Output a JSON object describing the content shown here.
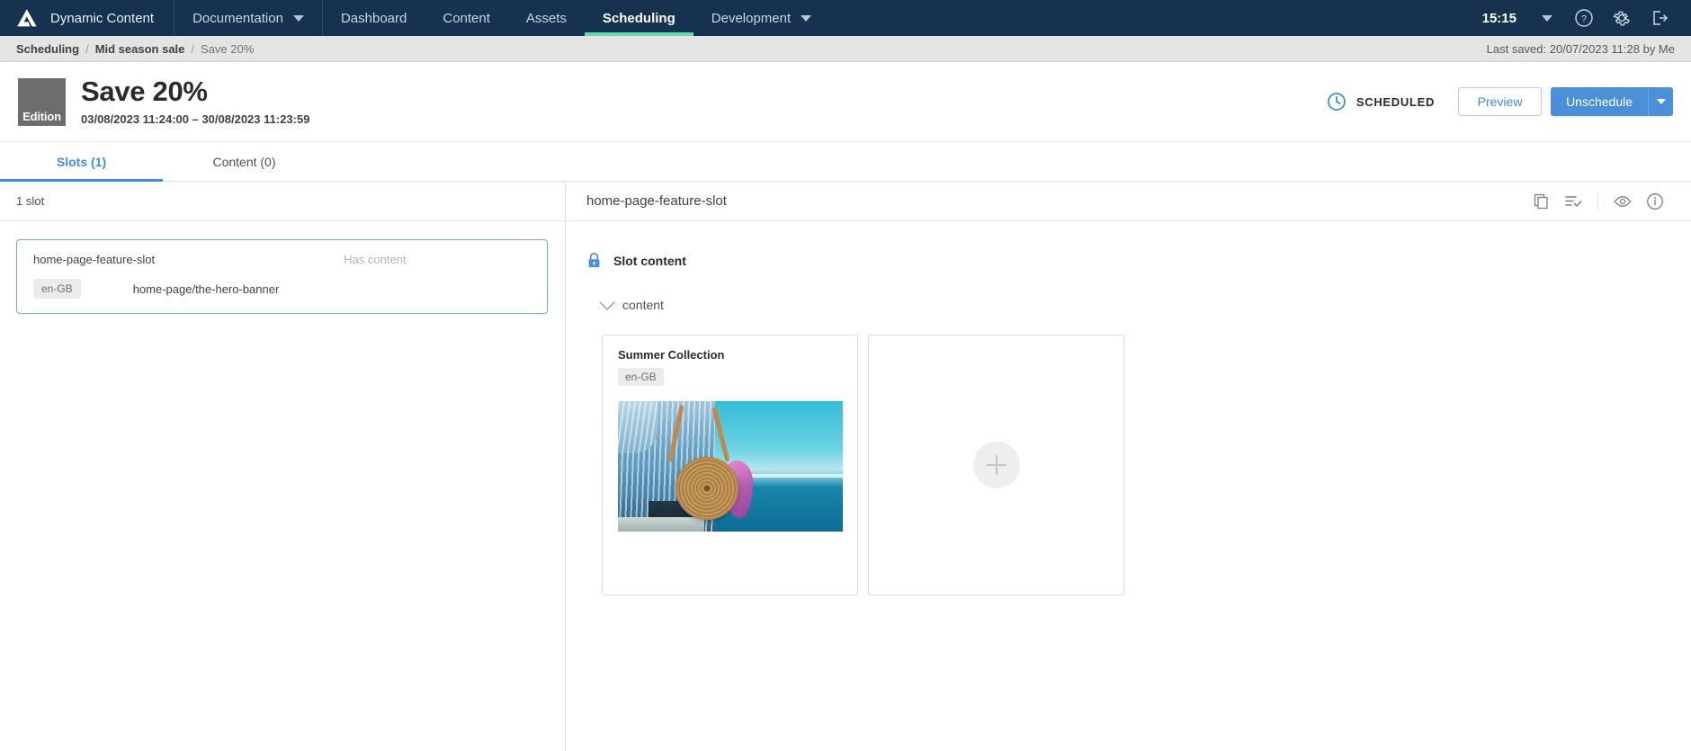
{
  "topnav": {
    "brand": "Dynamic Content",
    "brand_logo_icon": "amplience-logo-icon",
    "items": [
      {
        "label": "Documentation",
        "has_caret": true,
        "active": false
      },
      {
        "label": "Dashboard",
        "has_caret": false,
        "active": false
      },
      {
        "label": "Content",
        "has_caret": false,
        "active": false
      },
      {
        "label": "Assets",
        "has_caret": false,
        "active": false
      },
      {
        "label": "Scheduling",
        "has_caret": false,
        "active": true
      },
      {
        "label": "Development",
        "has_caret": true,
        "active": false
      }
    ],
    "time": "15:15",
    "icons": [
      "chevron-down-icon",
      "help-icon",
      "gear-icon",
      "logout-icon"
    ]
  },
  "breadcrumb": {
    "items": [
      "Scheduling",
      "Mid season sale",
      "Save 20%"
    ],
    "separator": "/",
    "last_saved": "Last saved: 20/07/2023 11:28 by Me"
  },
  "header": {
    "badge": "Edition",
    "title": "Save 20%",
    "dates": "03/08/2023 11:24:00  –  30/08/2023 11:23:59",
    "status": "SCHEDULED",
    "status_icon": "clock-icon",
    "status_color": "#3e8ede",
    "preview_label": "Preview",
    "primary_label": "Unschedule",
    "primary_color": "#4a90d9"
  },
  "tabs": [
    {
      "label": "Slots (1)",
      "active": true
    },
    {
      "label": "Content (0)",
      "active": false
    }
  ],
  "left_pane": {
    "count_label": "1 slot",
    "slots": [
      {
        "name": "home-page-feature-slot",
        "status": "Has content",
        "locale": "en-GB",
        "path": "home-page/the-hero-banner",
        "selected": true
      }
    ]
  },
  "right_pane": {
    "title": "home-page-feature-slot",
    "icons": [
      "duplicate-icon",
      "list-check-icon",
      "eye-icon",
      "info-icon"
    ],
    "section": {
      "lock_icon": "lock-icon",
      "lock_color": "#4a90d9",
      "title": "Slot content"
    },
    "group": {
      "chevron_icon": "chevron-down-icon",
      "label": "content"
    },
    "cards": [
      {
        "type": "content",
        "title": "Summer Collection",
        "locale": "en-GB",
        "image_alt": "woman-with-rattan-bag-by-the-sea"
      },
      {
        "type": "empty",
        "add_icon": "plus-icon"
      }
    ]
  }
}
